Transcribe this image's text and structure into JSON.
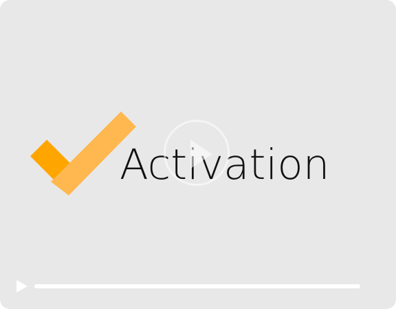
{
  "video": {
    "title": "Activation",
    "progress_fraction": 0,
    "colors": {
      "background": "#e8e8e9",
      "check_dark": "#ffa500",
      "check_light": "#ffb74f",
      "text": "#111111"
    }
  },
  "icons": {
    "logo": "checkmark-logo-icon",
    "big_play": "play-circle-icon",
    "small_play": "play-icon"
  }
}
